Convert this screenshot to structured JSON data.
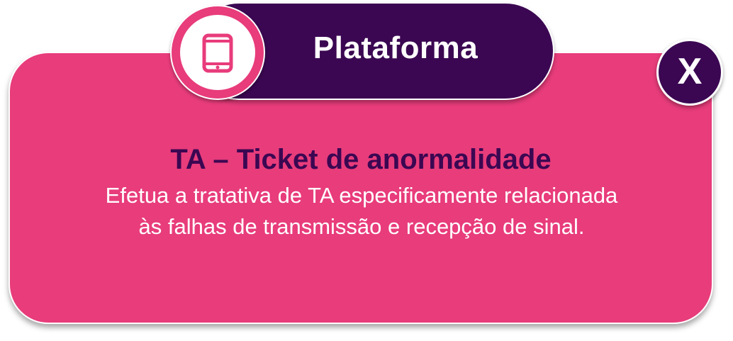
{
  "header": {
    "title": "Plataforma",
    "icon": "smartphone-icon"
  },
  "close_button": {
    "label": "X"
  },
  "content": {
    "title": "TA – Ticket de anormalidade",
    "body_line1": "Efetua a tratativa de TA especificamente relacionada",
    "body_line2": "às falhas de transmissão e recepção de sinal."
  },
  "colors": {
    "card": "#e83c7b",
    "header": "#3b0752",
    "title_text": "#3b0752",
    "body_text": "#ffffff"
  }
}
